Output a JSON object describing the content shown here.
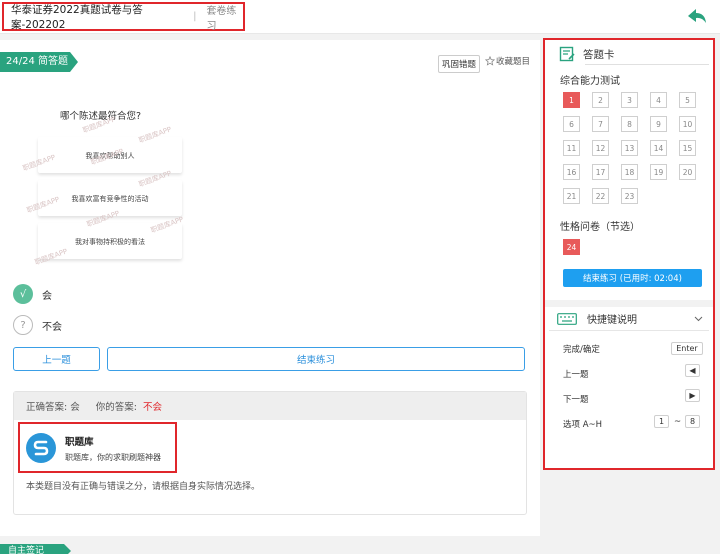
{
  "header": {
    "title": "华泰证券2022真题试卷与答案-202202",
    "separator": "|",
    "mode": "套卷练习"
  },
  "question": {
    "section_label": "24/24 简答题",
    "review_label": "巩固错题",
    "favorite_label": "收藏题目",
    "prompt": "哪个陈述最符合您?",
    "statements": [
      "我喜欢帮助别人",
      "我喜欢富有竞争性的活动",
      "我对事物持积极的看法"
    ],
    "watermark": "职题库APP",
    "options": [
      {
        "icon": "√",
        "label": "会",
        "selected": true
      },
      {
        "icon": "?",
        "label": "不会",
        "selected": false
      }
    ]
  },
  "nav": {
    "prev_label": "上一题",
    "end_label": "结束练习"
  },
  "answer": {
    "correct_label": "正确答案: 会",
    "yours_label": "你的答案:",
    "yours_value": "不会",
    "promo_name": "职题库",
    "promo_sub": "职题库，你的求职刷题神器",
    "note": "本类题目没有正确与错误之分，请根据自身实际情况选择。"
  },
  "next_section": "自主签记",
  "sidebar": {
    "card_title": "答题卡",
    "group1_title": "综合能力测试",
    "group1_items": [
      "1",
      "2",
      "3",
      "4",
      "5",
      "6",
      "7",
      "8",
      "9",
      "10",
      "11",
      "12",
      "13",
      "14",
      "15",
      "16",
      "17",
      "18",
      "19",
      "20",
      "21",
      "22",
      "23"
    ],
    "group1_done": [
      "1"
    ],
    "group2_title": "性格问卷（节选）",
    "group2_items": [
      "24"
    ],
    "end_button": "结束练习 (已用时: 02:04)",
    "shortcut_title": "快捷键说明",
    "shortcuts": [
      {
        "label": "完成/确定",
        "key": "Enter"
      },
      {
        "label": "上一题",
        "key": "◀"
      },
      {
        "label": "下一题",
        "key": "▶"
      },
      {
        "label": "选项 A~H",
        "key_from": "1",
        "key_sep": "~",
        "key_to": "8"
      }
    ]
  },
  "colors": {
    "accent_green": "#2aa37f",
    "accent_blue": "#1e9ff0",
    "highlight_red": "#e0262b",
    "answered_red": "#e85a5a"
  }
}
